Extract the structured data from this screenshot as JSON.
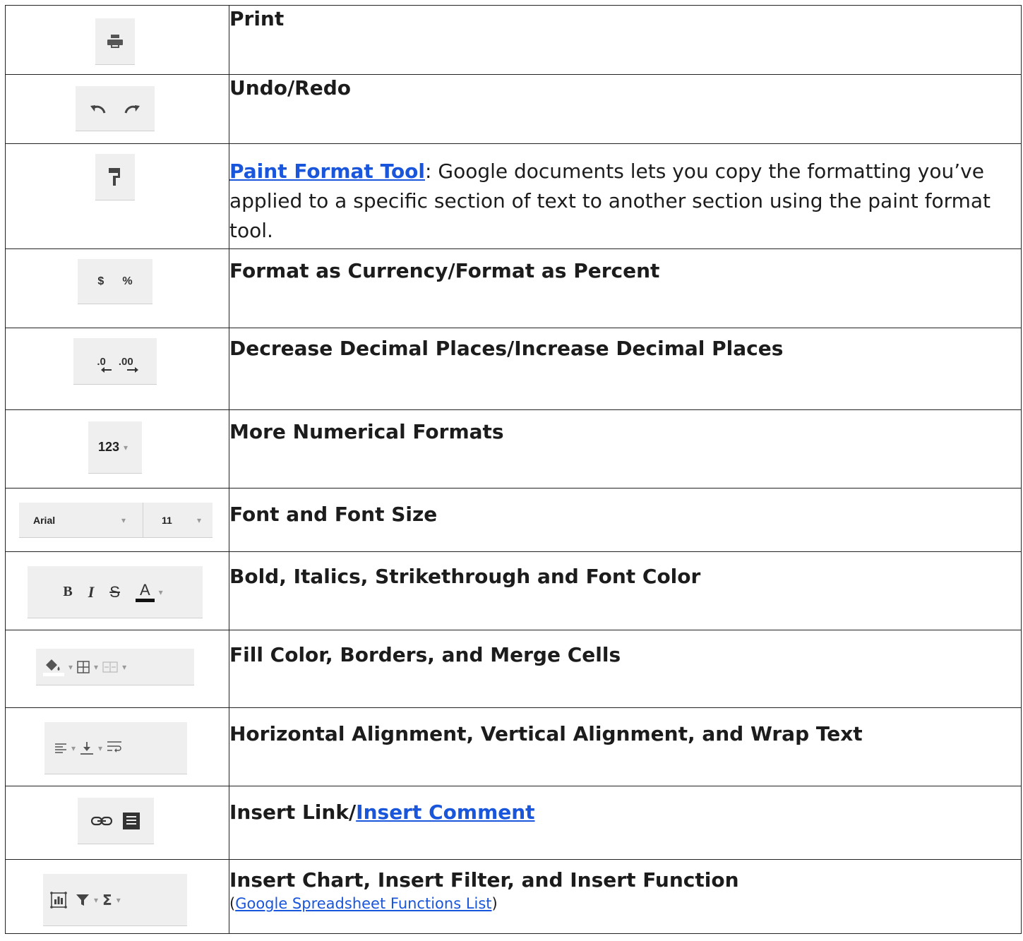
{
  "rows": [
    {
      "title": "Print"
    },
    {
      "title": "Undo/Redo"
    },
    {
      "link": "Paint Format Tool",
      "rest": ": Google documents lets you copy the formatting you’ve applied to a specific section of text to another section using the paint format tool."
    },
    {
      "title": "Format as Currency/Format as Percent",
      "icon_text": [
        "$",
        "%"
      ]
    },
    {
      "title": "Decrease Decimal Places/Increase Decimal Places",
      "icon_text": [
        ".0",
        ".00"
      ]
    },
    {
      "title": "More Numerical Formats",
      "icon_text": "123"
    },
    {
      "title": "Font and Font Size",
      "icon_text": [
        "Arial",
        "11"
      ]
    },
    {
      "title": "Bold, Italics, Strikethrough and Font Color",
      "icon_text": [
        "B",
        "I",
        "S",
        "A"
      ]
    },
    {
      "title": "Fill Color, Borders, and Merge Cells"
    },
    {
      "title": "Horizontal Alignment, Vertical Alignment, and Wrap Text"
    },
    {
      "title_plain": "Insert Link/",
      "title_link": "Insert Comment"
    },
    {
      "title": "Insert Chart, Insert Filter, and Insert Function",
      "note_open": "(",
      "note_link": "Google Spreadsheet Functions List",
      "note_close": ")"
    }
  ],
  "icons": {
    "print": "print-icon",
    "undo": "undo-icon",
    "redo": "redo-icon",
    "paint_format": "paint-roller-icon",
    "fill": "paint-bucket-icon",
    "borders": "borders-icon",
    "merge": "merge-cells-icon",
    "align": "align-left-icon",
    "valign": "align-bottom-icon",
    "wrap": "wrap-text-icon",
    "link": "link-icon",
    "comment": "comment-icon",
    "chart": "chart-icon",
    "filter": "filter-icon",
    "function": "sigma-icon"
  },
  "colors": {
    "link": "#1a56db",
    "toolbar_bg": "#efefef",
    "border": "#222222"
  }
}
